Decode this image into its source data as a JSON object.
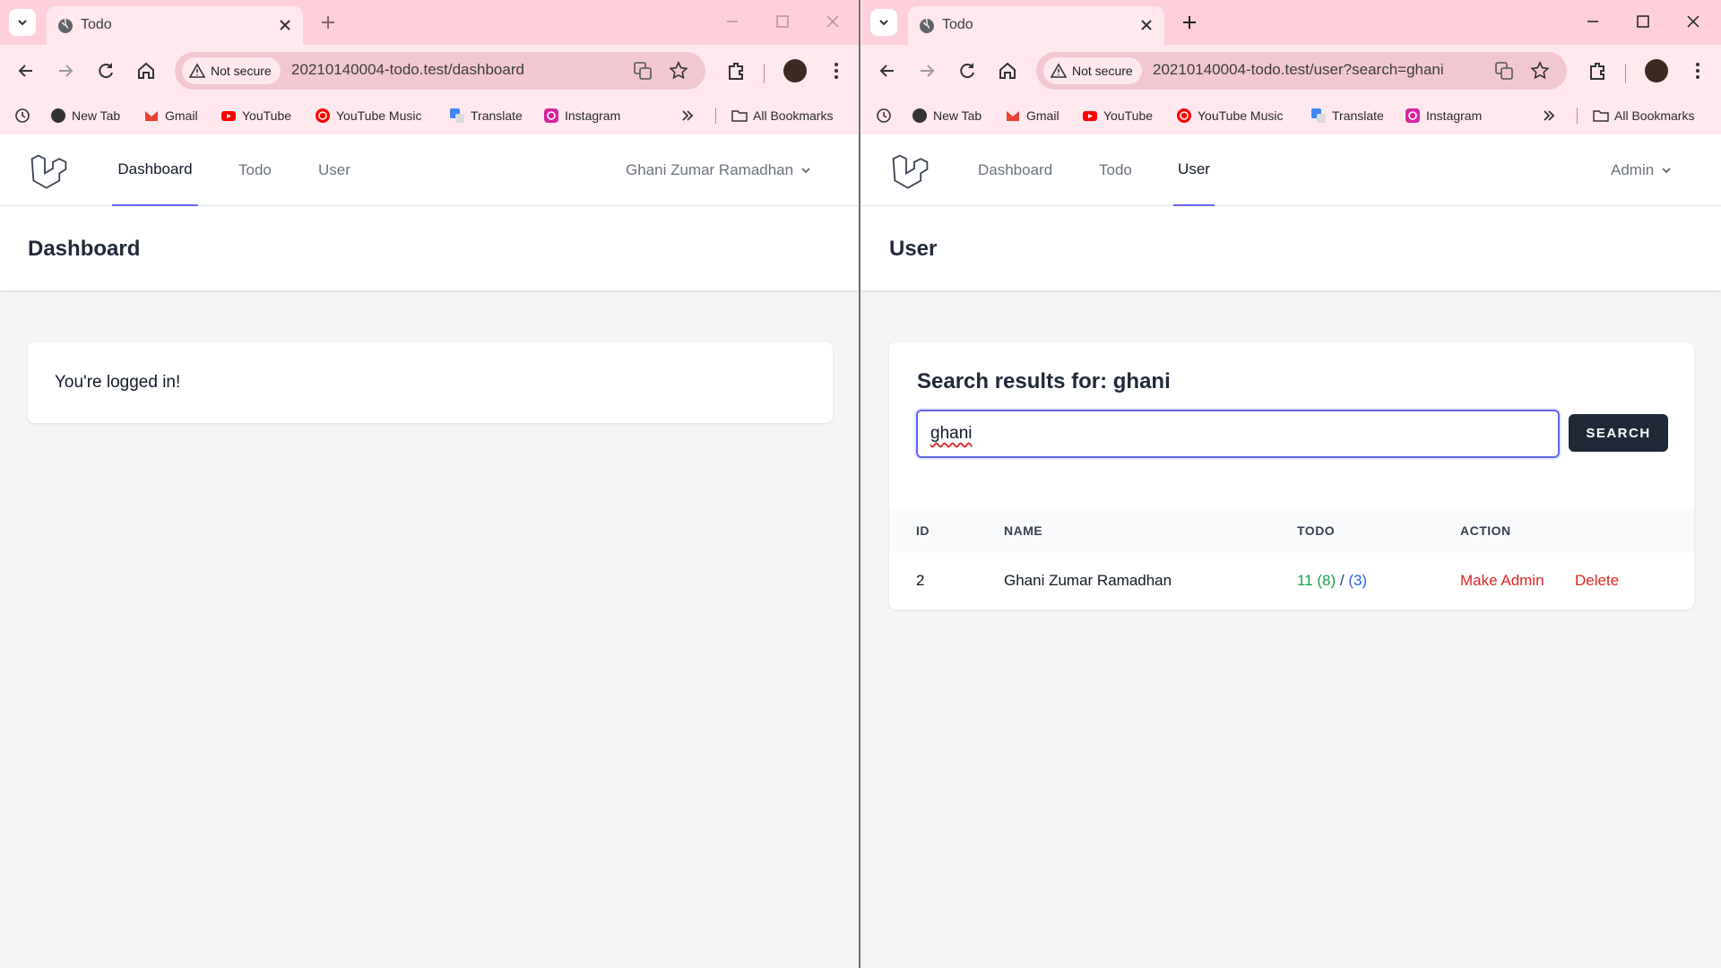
{
  "left": {
    "tab_title": "Todo",
    "security_chip": "Not secure",
    "url": "20210140004-todo.test/dashboard",
    "bookmarks": [
      "New Tab",
      "Gmail",
      "YouTube",
      "YouTube Music",
      "Translate",
      "Instagram"
    ],
    "all_bookmarks": "All Bookmarks",
    "nav": {
      "dashboard": "Dashboard",
      "todo": "Todo",
      "user": "User",
      "account": "Ghani Zumar Ramadhan"
    },
    "header_title": "Dashboard",
    "message": "You're logged in!"
  },
  "right": {
    "tab_title": "Todo",
    "security_chip": "Not secure",
    "url": "20210140004-todo.test/user?search=ghani",
    "bookmarks": [
      "New Tab",
      "Gmail",
      "YouTube",
      "YouTube Music",
      "Translate",
      "Instagram"
    ],
    "all_bookmarks": "All Bookmarks",
    "nav": {
      "dashboard": "Dashboard",
      "todo": "Todo",
      "user": "User",
      "account": "Admin"
    },
    "header_title": "User",
    "search": {
      "title": "Search results for: ghani",
      "value": "ghani",
      "button": "SEARCH"
    },
    "table": {
      "headers": [
        "ID",
        "NAME",
        "TODO",
        "ACTION"
      ],
      "rows": [
        {
          "id": "2",
          "name": "Ghani Zumar Ramadhan",
          "todo_total": "11",
          "todo_done": "(8)",
          "todo_sep": "/",
          "todo_pending": "(3)",
          "action_make_admin": "Make Admin",
          "action_delete": "Delete"
        }
      ]
    }
  },
  "colors": {
    "tabbar": "#ffd0dc",
    "toolbar": "#ffe8ee",
    "accent_indigo": "#6366f1",
    "todo_green": "#16a34a",
    "todo_blue": "#2563eb",
    "action_red": "#dc2626"
  }
}
